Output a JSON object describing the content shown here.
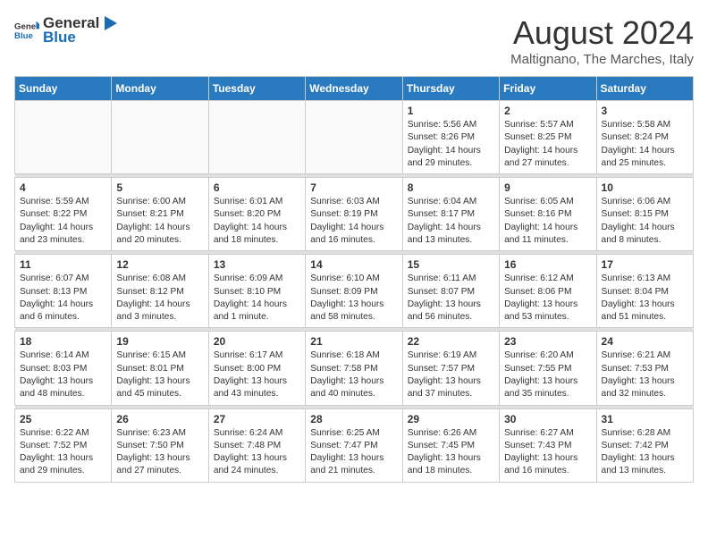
{
  "header": {
    "logo_general": "General",
    "logo_blue": "Blue",
    "month_year": "August 2024",
    "location": "Maltignano, The Marches, Italy"
  },
  "weekdays": [
    "Sunday",
    "Monday",
    "Tuesday",
    "Wednesday",
    "Thursday",
    "Friday",
    "Saturday"
  ],
  "weeks": [
    {
      "days": [
        {
          "num": "",
          "empty": true,
          "text": ""
        },
        {
          "num": "",
          "empty": true,
          "text": ""
        },
        {
          "num": "",
          "empty": true,
          "text": ""
        },
        {
          "num": "",
          "empty": true,
          "text": ""
        },
        {
          "num": "1",
          "empty": false,
          "text": "Sunrise: 5:56 AM\nSunset: 8:26 PM\nDaylight: 14 hours\nand 29 minutes."
        },
        {
          "num": "2",
          "empty": false,
          "text": "Sunrise: 5:57 AM\nSunset: 8:25 PM\nDaylight: 14 hours\nand 27 minutes."
        },
        {
          "num": "3",
          "empty": false,
          "text": "Sunrise: 5:58 AM\nSunset: 8:24 PM\nDaylight: 14 hours\nand 25 minutes."
        }
      ]
    },
    {
      "days": [
        {
          "num": "4",
          "empty": false,
          "text": "Sunrise: 5:59 AM\nSunset: 8:22 PM\nDaylight: 14 hours\nand 23 minutes."
        },
        {
          "num": "5",
          "empty": false,
          "text": "Sunrise: 6:00 AM\nSunset: 8:21 PM\nDaylight: 14 hours\nand 20 minutes."
        },
        {
          "num": "6",
          "empty": false,
          "text": "Sunrise: 6:01 AM\nSunset: 8:20 PM\nDaylight: 14 hours\nand 18 minutes."
        },
        {
          "num": "7",
          "empty": false,
          "text": "Sunrise: 6:03 AM\nSunset: 8:19 PM\nDaylight: 14 hours\nand 16 minutes."
        },
        {
          "num": "8",
          "empty": false,
          "text": "Sunrise: 6:04 AM\nSunset: 8:17 PM\nDaylight: 14 hours\nand 13 minutes."
        },
        {
          "num": "9",
          "empty": false,
          "text": "Sunrise: 6:05 AM\nSunset: 8:16 PM\nDaylight: 14 hours\nand 11 minutes."
        },
        {
          "num": "10",
          "empty": false,
          "text": "Sunrise: 6:06 AM\nSunset: 8:15 PM\nDaylight: 14 hours\nand 8 minutes."
        }
      ]
    },
    {
      "days": [
        {
          "num": "11",
          "empty": false,
          "text": "Sunrise: 6:07 AM\nSunset: 8:13 PM\nDaylight: 14 hours\nand 6 minutes."
        },
        {
          "num": "12",
          "empty": false,
          "text": "Sunrise: 6:08 AM\nSunset: 8:12 PM\nDaylight: 14 hours\nand 3 minutes."
        },
        {
          "num": "13",
          "empty": false,
          "text": "Sunrise: 6:09 AM\nSunset: 8:10 PM\nDaylight: 14 hours\nand 1 minute."
        },
        {
          "num": "14",
          "empty": false,
          "text": "Sunrise: 6:10 AM\nSunset: 8:09 PM\nDaylight: 13 hours\nand 58 minutes."
        },
        {
          "num": "15",
          "empty": false,
          "text": "Sunrise: 6:11 AM\nSunset: 8:07 PM\nDaylight: 13 hours\nand 56 minutes."
        },
        {
          "num": "16",
          "empty": false,
          "text": "Sunrise: 6:12 AM\nSunset: 8:06 PM\nDaylight: 13 hours\nand 53 minutes."
        },
        {
          "num": "17",
          "empty": false,
          "text": "Sunrise: 6:13 AM\nSunset: 8:04 PM\nDaylight: 13 hours\nand 51 minutes."
        }
      ]
    },
    {
      "days": [
        {
          "num": "18",
          "empty": false,
          "text": "Sunrise: 6:14 AM\nSunset: 8:03 PM\nDaylight: 13 hours\nand 48 minutes."
        },
        {
          "num": "19",
          "empty": false,
          "text": "Sunrise: 6:15 AM\nSunset: 8:01 PM\nDaylight: 13 hours\nand 45 minutes."
        },
        {
          "num": "20",
          "empty": false,
          "text": "Sunrise: 6:17 AM\nSunset: 8:00 PM\nDaylight: 13 hours\nand 43 minutes."
        },
        {
          "num": "21",
          "empty": false,
          "text": "Sunrise: 6:18 AM\nSunset: 7:58 PM\nDaylight: 13 hours\nand 40 minutes."
        },
        {
          "num": "22",
          "empty": false,
          "text": "Sunrise: 6:19 AM\nSunset: 7:57 PM\nDaylight: 13 hours\nand 37 minutes."
        },
        {
          "num": "23",
          "empty": false,
          "text": "Sunrise: 6:20 AM\nSunset: 7:55 PM\nDaylight: 13 hours\nand 35 minutes."
        },
        {
          "num": "24",
          "empty": false,
          "text": "Sunrise: 6:21 AM\nSunset: 7:53 PM\nDaylight: 13 hours\nand 32 minutes."
        }
      ]
    },
    {
      "days": [
        {
          "num": "25",
          "empty": false,
          "text": "Sunrise: 6:22 AM\nSunset: 7:52 PM\nDaylight: 13 hours\nand 29 minutes."
        },
        {
          "num": "26",
          "empty": false,
          "text": "Sunrise: 6:23 AM\nSunset: 7:50 PM\nDaylight: 13 hours\nand 27 minutes."
        },
        {
          "num": "27",
          "empty": false,
          "text": "Sunrise: 6:24 AM\nSunset: 7:48 PM\nDaylight: 13 hours\nand 24 minutes."
        },
        {
          "num": "28",
          "empty": false,
          "text": "Sunrise: 6:25 AM\nSunset: 7:47 PM\nDaylight: 13 hours\nand 21 minutes."
        },
        {
          "num": "29",
          "empty": false,
          "text": "Sunrise: 6:26 AM\nSunset: 7:45 PM\nDaylight: 13 hours\nand 18 minutes."
        },
        {
          "num": "30",
          "empty": false,
          "text": "Sunrise: 6:27 AM\nSunset: 7:43 PM\nDaylight: 13 hours\nand 16 minutes."
        },
        {
          "num": "31",
          "empty": false,
          "text": "Sunrise: 6:28 AM\nSunset: 7:42 PM\nDaylight: 13 hours\nand 13 minutes."
        }
      ]
    }
  ]
}
